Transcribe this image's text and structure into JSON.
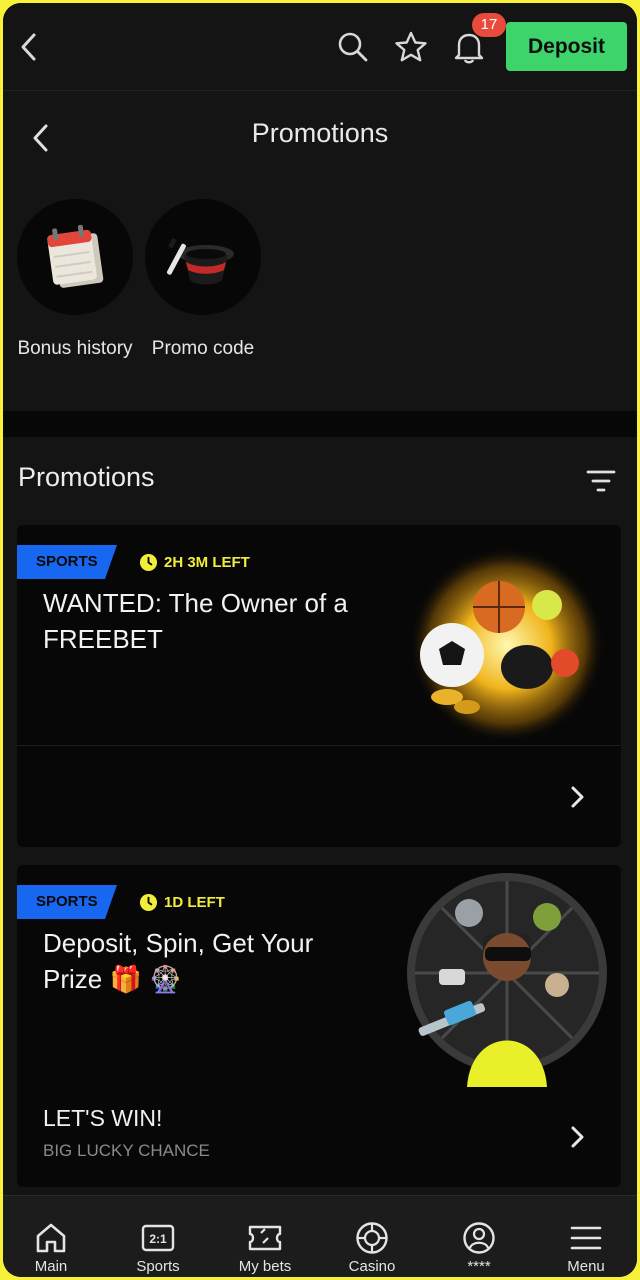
{
  "topbar": {
    "notification_count": "17",
    "deposit_label": "Deposit"
  },
  "page": {
    "title": "Promotions"
  },
  "quick_links": [
    {
      "label": "Bonus history"
    },
    {
      "label": "Promo code"
    }
  ],
  "section": {
    "title": "Promotions"
  },
  "promotions": [
    {
      "tag": "SPORTS",
      "time_left": "2H 3M LEFT",
      "title": "WANTED: The Owner of a FREEBET"
    },
    {
      "tag": "SPORTS",
      "time_left": "1D LEFT",
      "title": "Deposit, Spin, Get Your Prize 🎁 🎡",
      "subtitle": "LET'S WIN!",
      "caption": "BIG LUCKY CHANCE"
    }
  ],
  "bottom_nav": [
    {
      "label": "Main",
      "icon": "home-icon"
    },
    {
      "label": "Sports",
      "icon": "sports-icon"
    },
    {
      "label": "My bets",
      "icon": "ticket-icon"
    },
    {
      "label": "Casino",
      "icon": "casino-chip-icon"
    },
    {
      "label": "****",
      "icon": "profile-icon"
    },
    {
      "label": "Menu",
      "icon": "menu-icon"
    }
  ],
  "colors": {
    "accent_green": "#3ed46c",
    "tag_blue": "#1867f0",
    "timer_yellow": "#f1ee3a",
    "badge_red": "#e84a3c"
  }
}
